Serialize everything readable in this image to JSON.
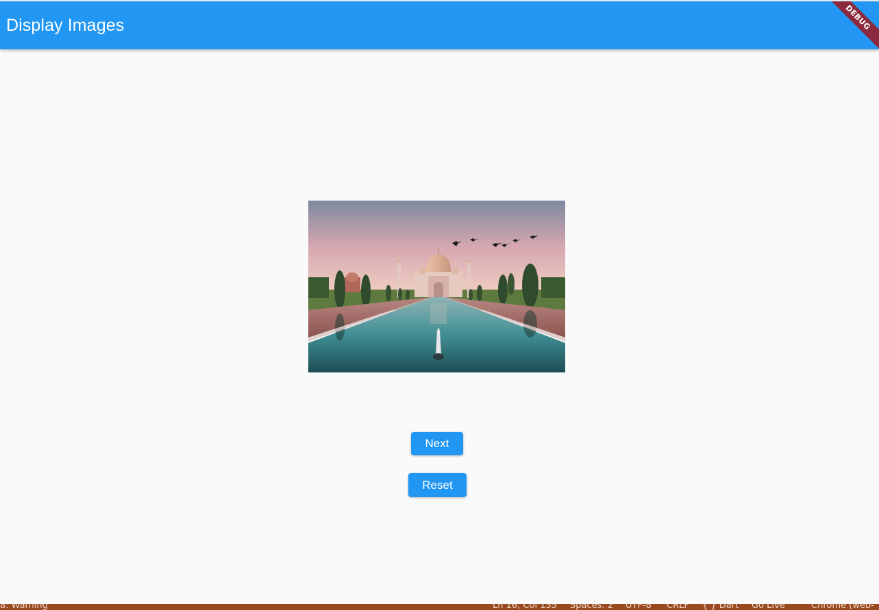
{
  "appbar": {
    "title": "Display Images",
    "debug_label": "DEBUG",
    "color": "#2196f3"
  },
  "image": {
    "subject": "taj-mahal-photo"
  },
  "buttons": {
    "next_label": "Next",
    "reset_label": "Reset"
  },
  "statusbar": {
    "left_text": "a: Warning",
    "position": "Ln 16, Col 135",
    "spaces": "Spaces: 2",
    "encoding": "UTF-8",
    "line_ending": "CRLF",
    "language": "{ } Dart",
    "live": "Go Live",
    "device": "Chrome (web-"
  }
}
